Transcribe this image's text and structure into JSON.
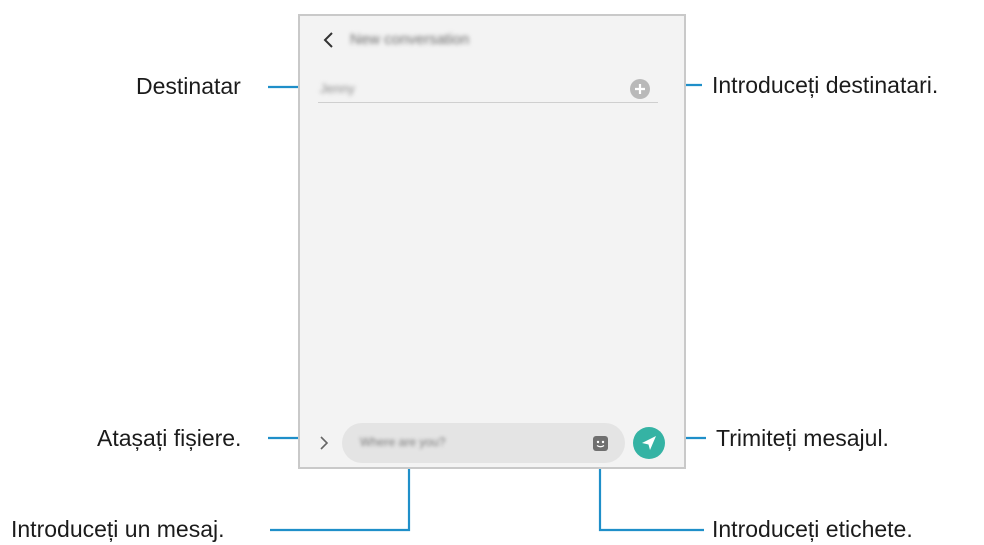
{
  "screen": {
    "title": "New conversation",
    "recipient_value": "Jenny",
    "message_placeholder": "Where are you?"
  },
  "callouts": {
    "recipient": "Destinatar",
    "add_recipients": "Introduceți destinatari.",
    "attach_files": "Atașați fișiere.",
    "send_message": "Trimiteți mesajul.",
    "enter_message": "Introduceți un mesaj.",
    "enter_stickers": "Introduceți etichete."
  },
  "colors": {
    "send_button": "#35b3a4",
    "callout_line": "#1f8fc9"
  },
  "icons": [
    "back-icon",
    "add-icon",
    "chevron-right-icon",
    "sticker-icon",
    "send-icon"
  ]
}
